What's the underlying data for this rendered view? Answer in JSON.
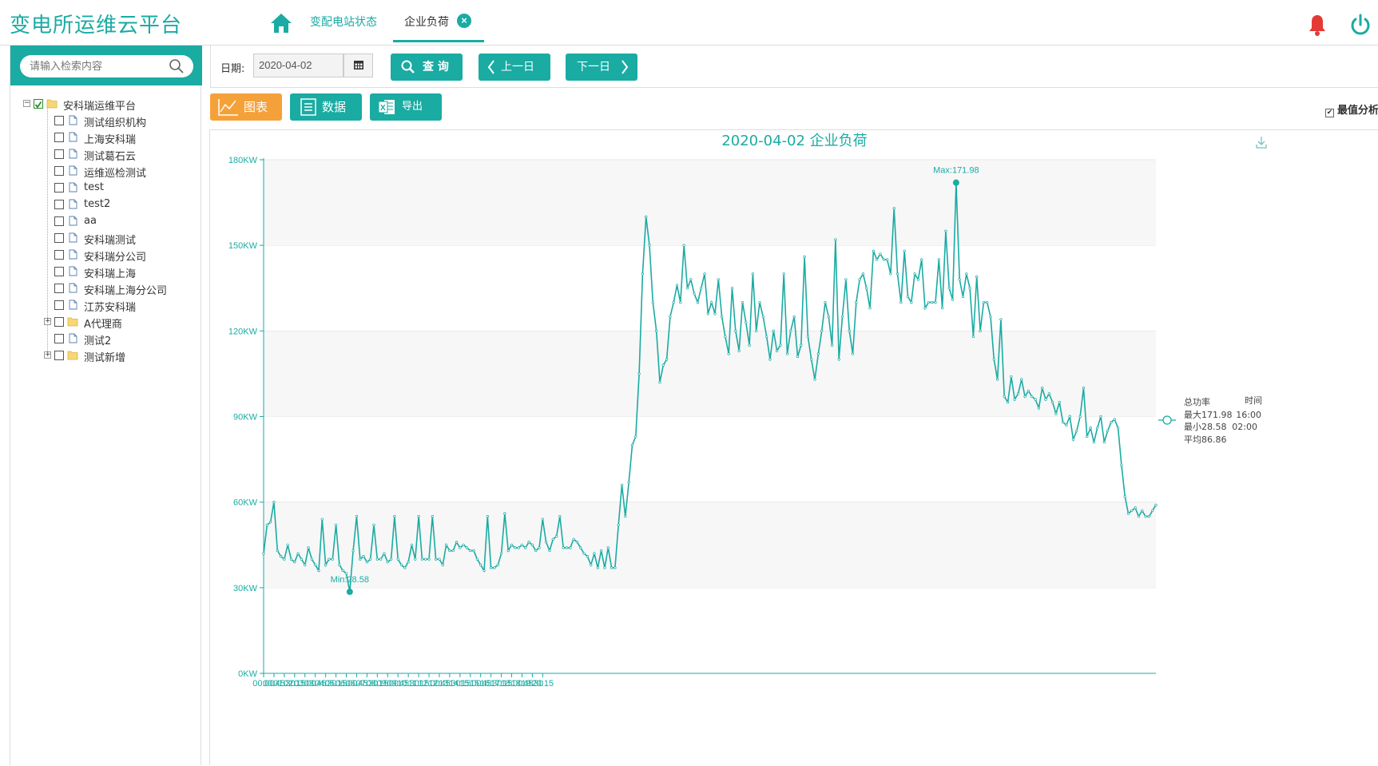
{
  "app": {
    "title": "变电所运维云平台",
    "tabs": [
      {
        "label": "变配电站状态"
      },
      {
        "label": "企业负荷"
      }
    ],
    "tab_close": "×"
  },
  "sidebar": {
    "search_placeholder": "请输入检索内容",
    "tree": [
      {
        "label": "安科瑞运维平台",
        "level": 0,
        "type": "folder",
        "checked": true,
        "expander": "−"
      },
      {
        "label": "测试组织机构",
        "level": 1,
        "type": "file"
      },
      {
        "label": "上海安科瑞",
        "level": 1,
        "type": "file"
      },
      {
        "label": "测试葛石云",
        "level": 1,
        "type": "file"
      },
      {
        "label": "运维巡检测试",
        "level": 1,
        "type": "file"
      },
      {
        "label": "test",
        "level": 1,
        "type": "file"
      },
      {
        "label": "test2",
        "level": 1,
        "type": "file"
      },
      {
        "label": "aa",
        "level": 1,
        "type": "file"
      },
      {
        "label": "安科瑞测试",
        "level": 1,
        "type": "file"
      },
      {
        "label": "安科瑞分公司",
        "level": 1,
        "type": "file"
      },
      {
        "label": "安科瑞上海",
        "level": 1,
        "type": "file"
      },
      {
        "label": "安科瑞上海分公司",
        "level": 1,
        "type": "file"
      },
      {
        "label": "江苏安科瑞",
        "level": 1,
        "type": "file"
      },
      {
        "label": "A代理商",
        "level": 1,
        "type": "folder",
        "expander": "+"
      },
      {
        "label": "测试2",
        "level": 1,
        "type": "file"
      },
      {
        "label": "测试新增",
        "level": 1,
        "type": "folder",
        "expander": "+"
      }
    ]
  },
  "toolbar": {
    "date_label": "日期:",
    "date_value": "2020-04-02",
    "query_label": "查 询",
    "prev_label": "上一日",
    "next_label": "下一日"
  },
  "viewbar": {
    "chart_label": "图表",
    "data_label": "数据",
    "export_label": "导出",
    "maxmin_label": "最值分析",
    "maxmin_checked": true
  },
  "colors": {
    "accent": "#1aaba3",
    "orange": "#f5a13a",
    "bell": "#e53935"
  },
  "chart_data": {
    "type": "line",
    "title": "2020-04-02 企业负荷",
    "ylim": [
      0,
      180
    ],
    "y_unit": "KW",
    "y_ticks": [
      "0KW",
      "30KW",
      "60KW",
      "90KW",
      "120KW",
      "150KW",
      "180KW"
    ],
    "x_ticks": [
      "00:00",
      "00:45",
      "01:30",
      "02:15",
      "03:00",
      "03:45",
      "04:30",
      "05:15",
      "06:00",
      "06:45",
      "07:30",
      "08:15",
      "09:00",
      "09:45",
      "10:30",
      "11:15",
      "12:00",
      "12:45",
      "13:30",
      "14:15",
      "15:00",
      "15:45",
      "16:30",
      "17:15",
      "18:00",
      "18:45",
      "19:30",
      "20:15"
    ],
    "interval_minutes": 15,
    "max_label": "Max:171.98",
    "min_label": "Min:28.58",
    "max_time": "16:00",
    "min_time": "02:00",
    "series": [
      {
        "name": "总功率",
        "values": [
          42,
          52,
          53,
          60,
          43,
          41,
          40,
          45,
          40,
          39,
          42,
          40,
          38,
          44,
          40,
          38,
          36,
          54,
          38,
          40,
          40,
          52,
          38,
          36,
          35,
          28.58,
          43,
          55,
          40,
          41,
          39,
          40,
          52,
          40,
          40,
          42,
          39,
          40,
          55,
          40,
          38,
          37,
          39,
          45,
          40,
          55,
          40,
          40,
          40,
          55,
          40,
          40,
          38,
          45,
          43,
          43,
          46,
          44,
          45,
          44,
          43,
          43,
          40,
          38,
          36,
          55,
          37,
          37,
          38,
          42,
          56,
          43,
          45,
          44,
          44,
          45,
          44,
          46,
          45,
          43,
          44,
          54,
          46,
          43,
          47,
          48,
          55,
          44,
          44,
          44,
          47,
          46,
          44,
          42,
          41,
          38,
          42,
          37,
          43,
          37,
          44,
          37,
          37,
          52,
          66,
          55,
          67,
          80,
          83,
          105,
          140,
          160,
          150,
          130,
          120,
          102,
          108,
          110,
          125,
          130,
          136,
          130,
          150,
          135,
          138,
          133,
          130,
          135,
          140,
          126,
          130,
          126,
          138,
          125,
          118,
          112,
          135,
          120,
          113,
          130,
          123,
          115,
          140,
          120,
          130,
          125,
          118,
          110,
          120,
          113,
          115,
          140,
          112,
          120,
          125,
          111,
          115,
          146,
          118,
          110,
          103,
          112,
          120,
          130,
          125,
          115,
          152,
          110,
          125,
          138,
          120,
          112,
          130,
          138,
          140,
          135,
          128,
          148,
          145,
          147,
          145,
          145,
          140,
          163,
          140,
          130,
          148,
          132,
          130,
          140,
          138,
          145,
          128,
          130,
          130,
          130,
          145,
          128,
          155,
          135,
          131,
          171.98,
          138,
          132,
          140,
          135,
          118,
          139,
          120,
          130,
          130,
          125,
          110,
          103,
          124,
          97,
          95,
          104,
          96,
          98,
          103,
          97,
          99,
          97,
          96,
          93,
          100,
          96,
          98,
          95,
          91,
          95,
          88,
          87,
          90,
          82,
          85,
          90,
          100,
          83,
          86,
          81,
          86,
          90,
          81,
          85,
          88,
          89,
          86,
          73,
          62,
          56,
          57,
          58,
          55,
          57,
          55,
          55,
          57,
          59
        ]
      }
    ],
    "legend": {
      "title": "总功率",
      "time_label": "时间",
      "max_text": "最大171.98",
      "min_text": "最小28.58",
      "avg_text": "平均86.86"
    }
  }
}
